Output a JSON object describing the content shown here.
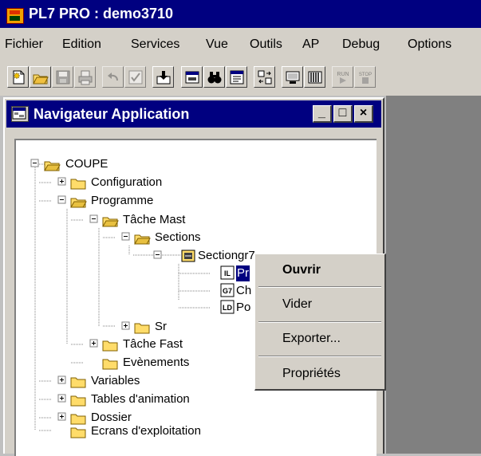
{
  "app": {
    "title": "PL7 PRO : demo3710"
  },
  "menubar": {
    "items": [
      {
        "label": "Fichier"
      },
      {
        "label": "Edition"
      },
      {
        "label": "Services"
      },
      {
        "label": "Vue"
      },
      {
        "label": "Outils"
      },
      {
        "label": "AP"
      },
      {
        "label": "Debug"
      },
      {
        "label": "Options"
      }
    ]
  },
  "toolbar": {
    "buttons": [
      {
        "icon": "new-document-icon"
      },
      {
        "icon": "open-folder-icon"
      },
      {
        "icon": "save-disk-icon",
        "disabled": true
      },
      {
        "icon": "print-icon",
        "disabled": true
      },
      {
        "icon": "undo-icon",
        "disabled": true
      },
      {
        "icon": "validate-check-icon",
        "disabled": true
      },
      {
        "icon": "import-export-icon"
      },
      {
        "icon": "window-icon"
      },
      {
        "icon": "binoculars-icon"
      },
      {
        "icon": "application-browser-icon"
      },
      {
        "icon": "transfer-icon"
      },
      {
        "icon": "connect-icon"
      },
      {
        "icon": "memory-icon"
      },
      {
        "icon": "run-icon",
        "label": "RUN",
        "disabled": true
      },
      {
        "icon": "stop-icon",
        "label": "STOP",
        "disabled": true
      }
    ]
  },
  "navigator": {
    "title": "Navigateur Application",
    "window_buttons": {
      "minimize": "_",
      "maximize": "□",
      "close": "×"
    },
    "tree": {
      "root": "COUPE",
      "configuration": "Configuration",
      "programme": "Programme",
      "tache_mast": "Tâche Mast",
      "sections": "Sections",
      "sectiongr7": "Sectiongr7",
      "prl": "Pr",
      "chart": "Ch",
      "post": "Po",
      "sr": "Sr",
      "tache_fast": "Tâche Fast",
      "evenements": "Evènements",
      "variables": "Variables",
      "tables_animation": "Tables d'animation",
      "dossier": "Dossier",
      "ecrans": "Ecrans d'exploitation",
      "type_il": "IL",
      "type_g7": "G7",
      "type_ld": "LD"
    }
  },
  "context_menu": {
    "items": [
      {
        "label": "Ouvrir",
        "bold": true
      },
      {
        "label": "Vider"
      },
      {
        "label": "Exporter..."
      },
      {
        "label": "Propriétés"
      }
    ]
  },
  "colors": {
    "title_bar": "#000080",
    "chrome": "#d4d0c8",
    "desktop": "#808080",
    "folder": "#ffdc6a",
    "selection": "#000080"
  }
}
